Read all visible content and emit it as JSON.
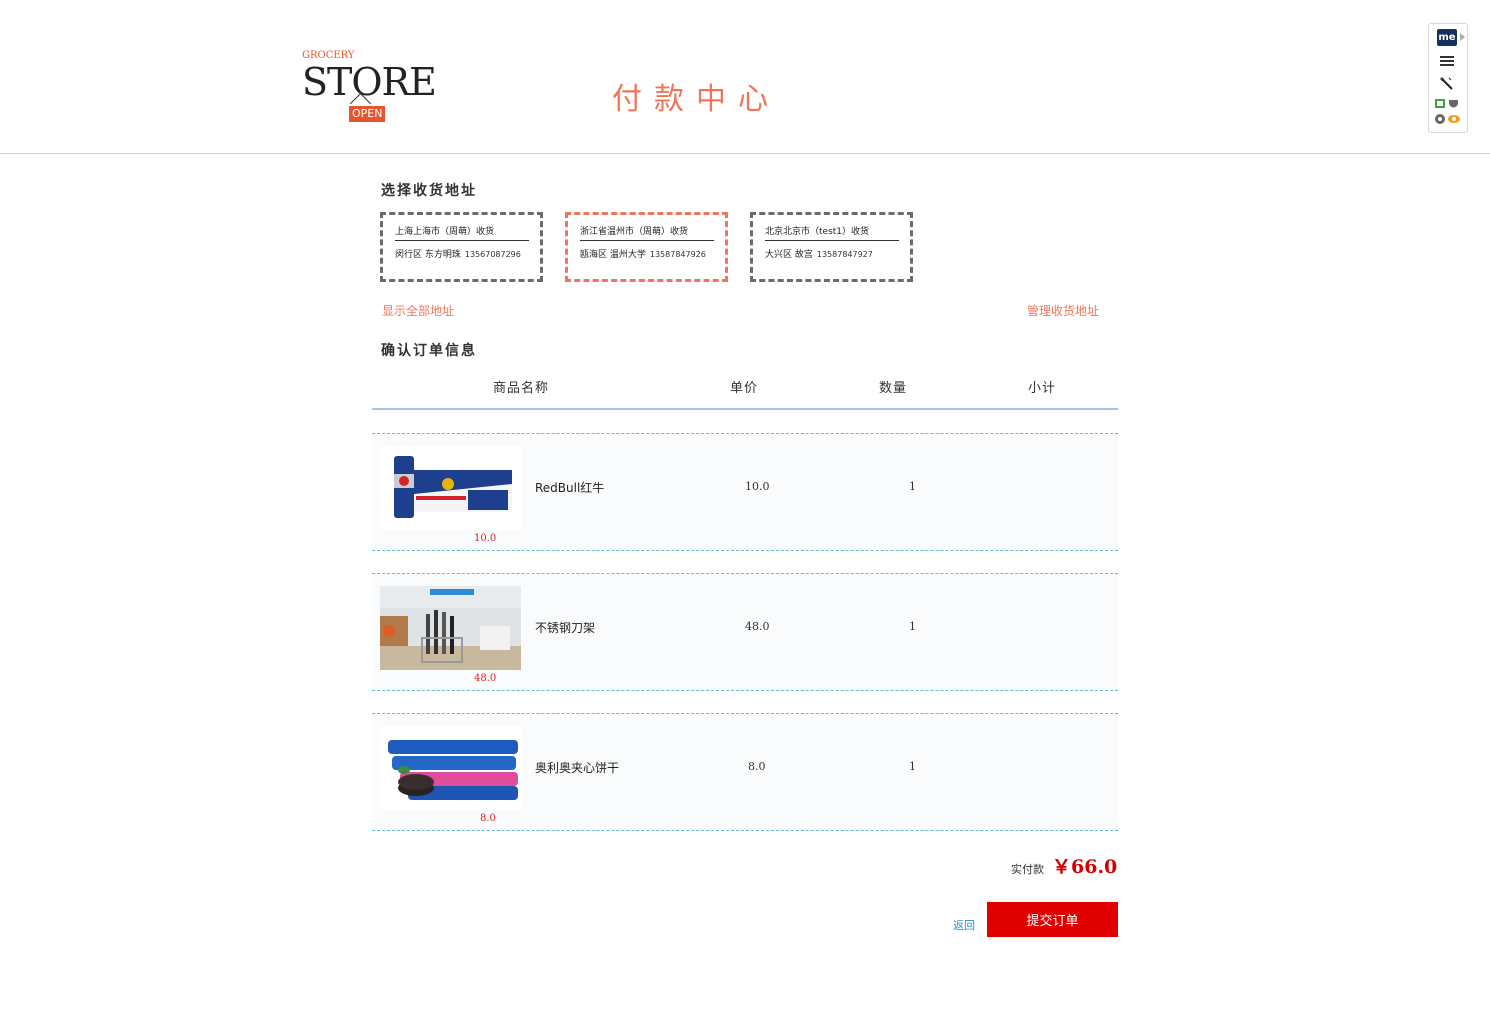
{
  "header": {
    "logo": {
      "grocery": "GROCERY",
      "store": "STORE",
      "open": "OPEN"
    },
    "title": "付款中心"
  },
  "extension": {
    "me_label": "me"
  },
  "address_section": {
    "title": "选择收货地址",
    "cards": [
      {
        "line1": "上海上海市（周萌）收货",
        "district": "闵行区 东方明珠",
        "phone": "13567087296",
        "selected": false
      },
      {
        "line1": "浙江省温州市（周萌）收货",
        "district": "瓯海区 温州大学",
        "phone": "13587847926",
        "selected": true
      },
      {
        "line1": "北京北京市（test1）收货",
        "district": "大兴区 故宫",
        "phone": "13587847927",
        "selected": false
      }
    ],
    "show_all": "显示全部地址",
    "manage": "管理收货地址"
  },
  "order_section": {
    "title": "确认订单信息",
    "columns": [
      "商品名称",
      "单价",
      "数量",
      "小计"
    ],
    "items": [
      {
        "name": "RedBull红牛",
        "price": "10.0",
        "qty": "1",
        "thumb_price": "10.0",
        "image": "redbull-can-image"
      },
      {
        "name": "不锈钢刀架",
        "price": "48.0",
        "qty": "1",
        "thumb_price": "48.0",
        "image": "knife-rack-image"
      },
      {
        "name": "奥利奥夹心饼干",
        "price": "8.0",
        "qty": "1",
        "thumb_price": "8.0",
        "image": "oreo-pack-image"
      }
    ]
  },
  "summary": {
    "total_label": "实付款",
    "total_value": "￥66.0"
  },
  "actions": {
    "back": "返回",
    "submit": "提交订单"
  },
  "colors": {
    "accent": "#f0765a",
    "price_red": "#e02020",
    "submit_bg": "#e00000",
    "link_blue": "#2a8fd0"
  }
}
